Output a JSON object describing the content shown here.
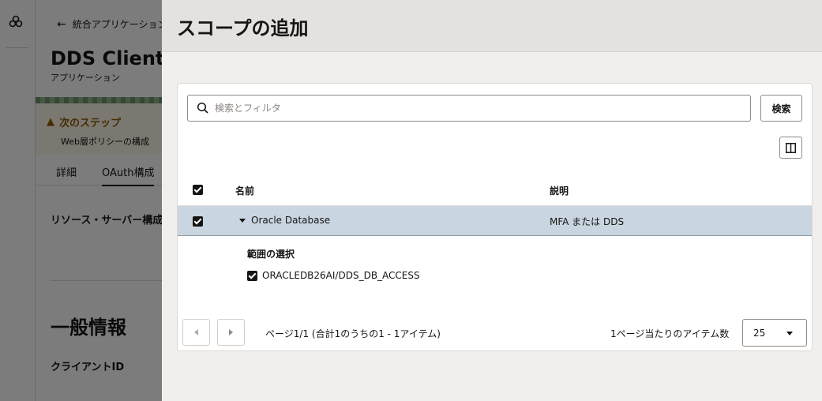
{
  "background": {
    "back_link": "統合アプリケーション",
    "app_title": "DDS Client",
    "app_subtitle": "アプリケーション",
    "next_step_title": "次のステップ",
    "next_step_desc": "Web層ポリシーの構成",
    "tabs": [
      "詳細",
      "OAuth構成"
    ],
    "resource_server_label": "リソース・サーバー構成",
    "general_info_title": "一般情報",
    "client_id_label": "クライアントID"
  },
  "drawer": {
    "title": "スコープの追加",
    "search": {
      "placeholder": "検索とフィルタ",
      "value": "",
      "button_label": "検索"
    },
    "table": {
      "columns": [
        "名前",
        "説明"
      ],
      "header_checked": true,
      "rows": [
        {
          "name": "Oracle Database",
          "description": "MFA または DDS",
          "checked": true,
          "expanded": true
        }
      ]
    },
    "scope_selection": {
      "title": "範囲の選択",
      "items": [
        {
          "label": "ORACLEDB26AI/DDS_DB_ACCESS",
          "checked": true
        }
      ]
    },
    "pagination": {
      "info": "ページ1/1 (合計1のうちの1 - 1アイテム)",
      "items_per_page_label": "1ページ当たりのアイテム数",
      "items_per_page": "25"
    }
  }
}
